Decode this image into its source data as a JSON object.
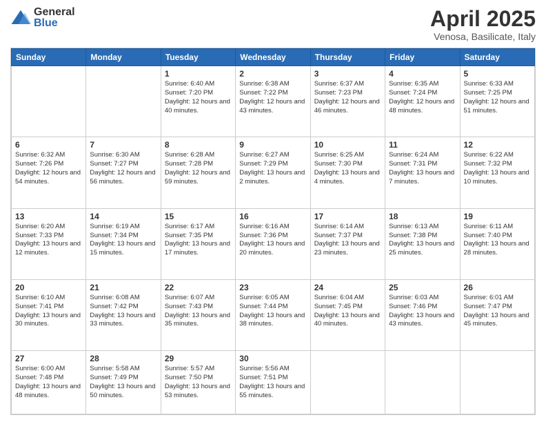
{
  "logo": {
    "general": "General",
    "blue": "Blue"
  },
  "header": {
    "month": "April 2025",
    "location": "Venosa, Basilicate, Italy"
  },
  "weekdays": [
    "Sunday",
    "Monday",
    "Tuesday",
    "Wednesday",
    "Thursday",
    "Friday",
    "Saturday"
  ],
  "days": [
    {
      "date": "",
      "info": ""
    },
    {
      "date": "",
      "info": ""
    },
    {
      "date": "1",
      "sunrise": "6:40 AM",
      "sunset": "7:20 PM",
      "daylight": "12 hours and 40 minutes."
    },
    {
      "date": "2",
      "sunrise": "6:38 AM",
      "sunset": "7:22 PM",
      "daylight": "12 hours and 43 minutes."
    },
    {
      "date": "3",
      "sunrise": "6:37 AM",
      "sunset": "7:23 PM",
      "daylight": "12 hours and 46 minutes."
    },
    {
      "date": "4",
      "sunrise": "6:35 AM",
      "sunset": "7:24 PM",
      "daylight": "12 hours and 48 minutes."
    },
    {
      "date": "5",
      "sunrise": "6:33 AM",
      "sunset": "7:25 PM",
      "daylight": "12 hours and 51 minutes."
    },
    {
      "date": "6",
      "sunrise": "6:32 AM",
      "sunset": "7:26 PM",
      "daylight": "12 hours and 54 minutes."
    },
    {
      "date": "7",
      "sunrise": "6:30 AM",
      "sunset": "7:27 PM",
      "daylight": "12 hours and 56 minutes."
    },
    {
      "date": "8",
      "sunrise": "6:28 AM",
      "sunset": "7:28 PM",
      "daylight": "12 hours and 59 minutes."
    },
    {
      "date": "9",
      "sunrise": "6:27 AM",
      "sunset": "7:29 PM",
      "daylight": "13 hours and 2 minutes."
    },
    {
      "date": "10",
      "sunrise": "6:25 AM",
      "sunset": "7:30 PM",
      "daylight": "13 hours and 4 minutes."
    },
    {
      "date": "11",
      "sunrise": "6:24 AM",
      "sunset": "7:31 PM",
      "daylight": "13 hours and 7 minutes."
    },
    {
      "date": "12",
      "sunrise": "6:22 AM",
      "sunset": "7:32 PM",
      "daylight": "13 hours and 10 minutes."
    },
    {
      "date": "13",
      "sunrise": "6:20 AM",
      "sunset": "7:33 PM",
      "daylight": "13 hours and 12 minutes."
    },
    {
      "date": "14",
      "sunrise": "6:19 AM",
      "sunset": "7:34 PM",
      "daylight": "13 hours and 15 minutes."
    },
    {
      "date": "15",
      "sunrise": "6:17 AM",
      "sunset": "7:35 PM",
      "daylight": "13 hours and 17 minutes."
    },
    {
      "date": "16",
      "sunrise": "6:16 AM",
      "sunset": "7:36 PM",
      "daylight": "13 hours and 20 minutes."
    },
    {
      "date": "17",
      "sunrise": "6:14 AM",
      "sunset": "7:37 PM",
      "daylight": "13 hours and 23 minutes."
    },
    {
      "date": "18",
      "sunrise": "6:13 AM",
      "sunset": "7:38 PM",
      "daylight": "13 hours and 25 minutes."
    },
    {
      "date": "19",
      "sunrise": "6:11 AM",
      "sunset": "7:40 PM",
      "daylight": "13 hours and 28 minutes."
    },
    {
      "date": "20",
      "sunrise": "6:10 AM",
      "sunset": "7:41 PM",
      "daylight": "13 hours and 30 minutes."
    },
    {
      "date": "21",
      "sunrise": "6:08 AM",
      "sunset": "7:42 PM",
      "daylight": "13 hours and 33 minutes."
    },
    {
      "date": "22",
      "sunrise": "6:07 AM",
      "sunset": "7:43 PM",
      "daylight": "13 hours and 35 minutes."
    },
    {
      "date": "23",
      "sunrise": "6:05 AM",
      "sunset": "7:44 PM",
      "daylight": "13 hours and 38 minutes."
    },
    {
      "date": "24",
      "sunrise": "6:04 AM",
      "sunset": "7:45 PM",
      "daylight": "13 hours and 40 minutes."
    },
    {
      "date": "25",
      "sunrise": "6:03 AM",
      "sunset": "7:46 PM",
      "daylight": "13 hours and 43 minutes."
    },
    {
      "date": "26",
      "sunrise": "6:01 AM",
      "sunset": "7:47 PM",
      "daylight": "13 hours and 45 minutes."
    },
    {
      "date": "27",
      "sunrise": "6:00 AM",
      "sunset": "7:48 PM",
      "daylight": "13 hours and 48 minutes."
    },
    {
      "date": "28",
      "sunrise": "5:58 AM",
      "sunset": "7:49 PM",
      "daylight": "13 hours and 50 minutes."
    },
    {
      "date": "29",
      "sunrise": "5:57 AM",
      "sunset": "7:50 PM",
      "daylight": "13 hours and 53 minutes."
    },
    {
      "date": "30",
      "sunrise": "5:56 AM",
      "sunset": "7:51 PM",
      "daylight": "13 hours and 55 minutes."
    },
    {
      "date": "",
      "info": ""
    },
    {
      "date": "",
      "info": ""
    },
    {
      "date": "",
      "info": ""
    },
    {
      "date": "",
      "info": ""
    }
  ]
}
